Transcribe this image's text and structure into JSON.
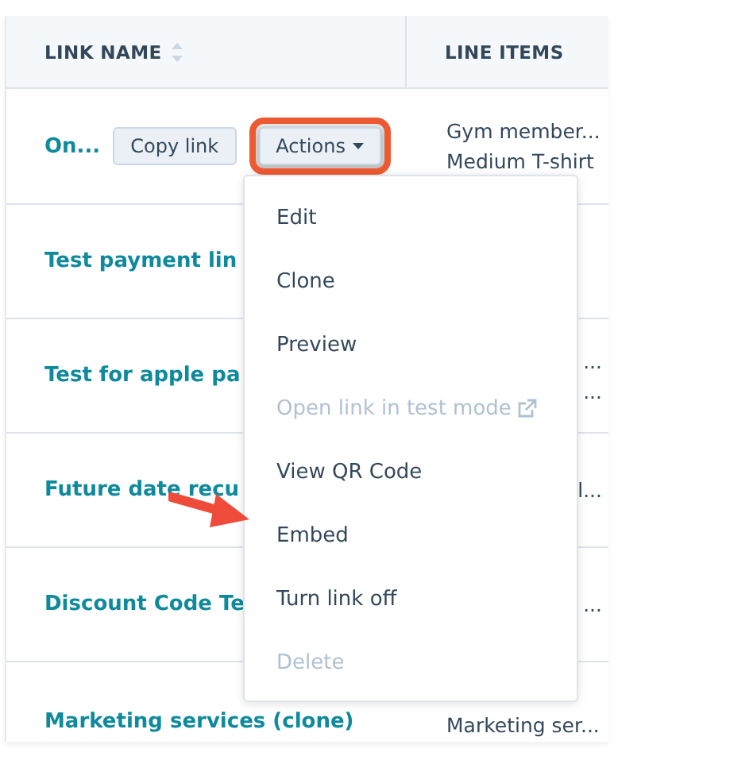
{
  "table": {
    "columns": [
      {
        "label": "LINK NAME",
        "sortable": true
      },
      {
        "label": "LINE ITEMS",
        "sortable": false
      }
    ],
    "rows": [
      {
        "name": "On...",
        "copy_button": "Copy link",
        "actions_button": "Actions",
        "line_items": [
          "Gym member...",
          "Medium T-shirt"
        ]
      },
      {
        "name": "Test payment lin",
        "line_items": []
      },
      {
        "name": "Test for apple pa",
        "line_items": [
          "...",
          "..."
        ]
      },
      {
        "name": "Future date recu",
        "line_items": [
          "l..."
        ]
      },
      {
        "name": "Discount Code Te",
        "line_items": [
          "..."
        ]
      },
      {
        "name": "Marketing services (clone)",
        "line_items": [
          "Marketing ser..."
        ]
      }
    ]
  },
  "actions_menu": {
    "items": [
      {
        "label": "Edit",
        "disabled": false
      },
      {
        "label": "Clone",
        "disabled": false
      },
      {
        "label": "Preview",
        "disabled": false
      },
      {
        "label": "Open link in test mode",
        "disabled": true,
        "external": true
      },
      {
        "label": "View QR Code",
        "disabled": false
      },
      {
        "label": "Embed",
        "disabled": false,
        "highlighted": true
      },
      {
        "label": "Turn link off",
        "disabled": false
      },
      {
        "label": "Delete",
        "disabled": true
      }
    ]
  }
}
